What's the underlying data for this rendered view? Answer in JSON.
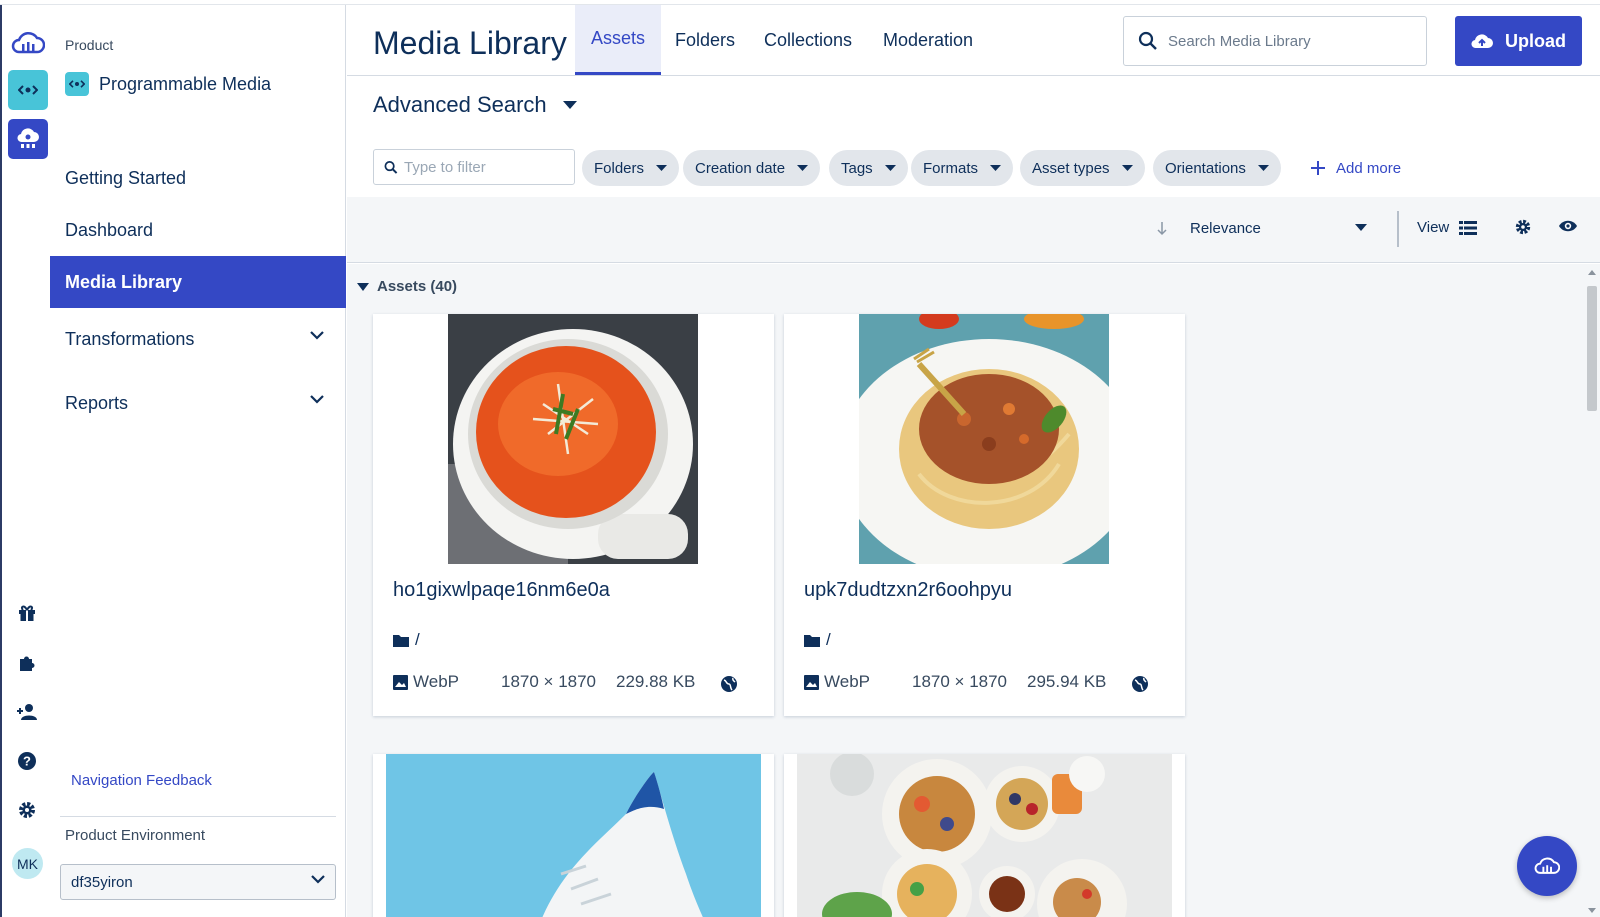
{
  "colors": {
    "brand": "#3448c5",
    "accent_teal": "#48c4d8",
    "text": "#0e2f5a",
    "muted": "#384a5f",
    "surface": "#f4f6f8"
  },
  "rail": {
    "icons": [
      "cloudinary-logo-icon",
      "programmable-media-icon",
      "dam-icon",
      "gift-icon",
      "puzzle-icon",
      "add-user-icon",
      "help-icon",
      "settings-icon"
    ],
    "avatar_initials": "MK"
  },
  "sidebar": {
    "product_label": "Product",
    "product_name": "Programmable Media",
    "items": [
      {
        "label": "Getting Started"
      },
      {
        "label": "Dashboard"
      },
      {
        "label": "Media Library",
        "active": true
      },
      {
        "label": "Transformations",
        "expandable": true
      },
      {
        "label": "Reports",
        "expandable": true
      }
    ],
    "feedback_link": "Navigation Feedback",
    "environment_label": "Product Environment",
    "environment_value": "df35yiron"
  },
  "header": {
    "title": "Media Library",
    "tabs": [
      {
        "label": "Assets",
        "active": true
      },
      {
        "label": "Folders"
      },
      {
        "label": "Collections"
      },
      {
        "label": "Moderation"
      }
    ],
    "search_placeholder": "Search Media Library",
    "upload_label": "Upload"
  },
  "search": {
    "title": "Advanced Search",
    "filter_placeholder": "Type to filter",
    "chips": [
      "Folders",
      "Creation date",
      "Tags",
      "Formats",
      "Asset types",
      "Orientations"
    ],
    "add_more": "Add more"
  },
  "toolbar": {
    "sort_value": "Relevance",
    "view_label": "View"
  },
  "assets": {
    "heading": "Assets (40)",
    "items": [
      {
        "name": "ho1gixwlpaqe16nm6e0a",
        "folder": "/",
        "format": "WebP",
        "dimensions": "1870 × 1870",
        "size": "229.88 KB",
        "image": "tomato-soup"
      },
      {
        "name": "upk7dudtzxn2r6oohpyu",
        "folder": "/",
        "format": "WebP",
        "dimensions": "1870 × 1870",
        "size": "295.94 KB",
        "image": "spaghetti-bolognese"
      },
      {
        "image": "white-sneaker"
      },
      {
        "image": "breakfast-spread"
      }
    ]
  }
}
